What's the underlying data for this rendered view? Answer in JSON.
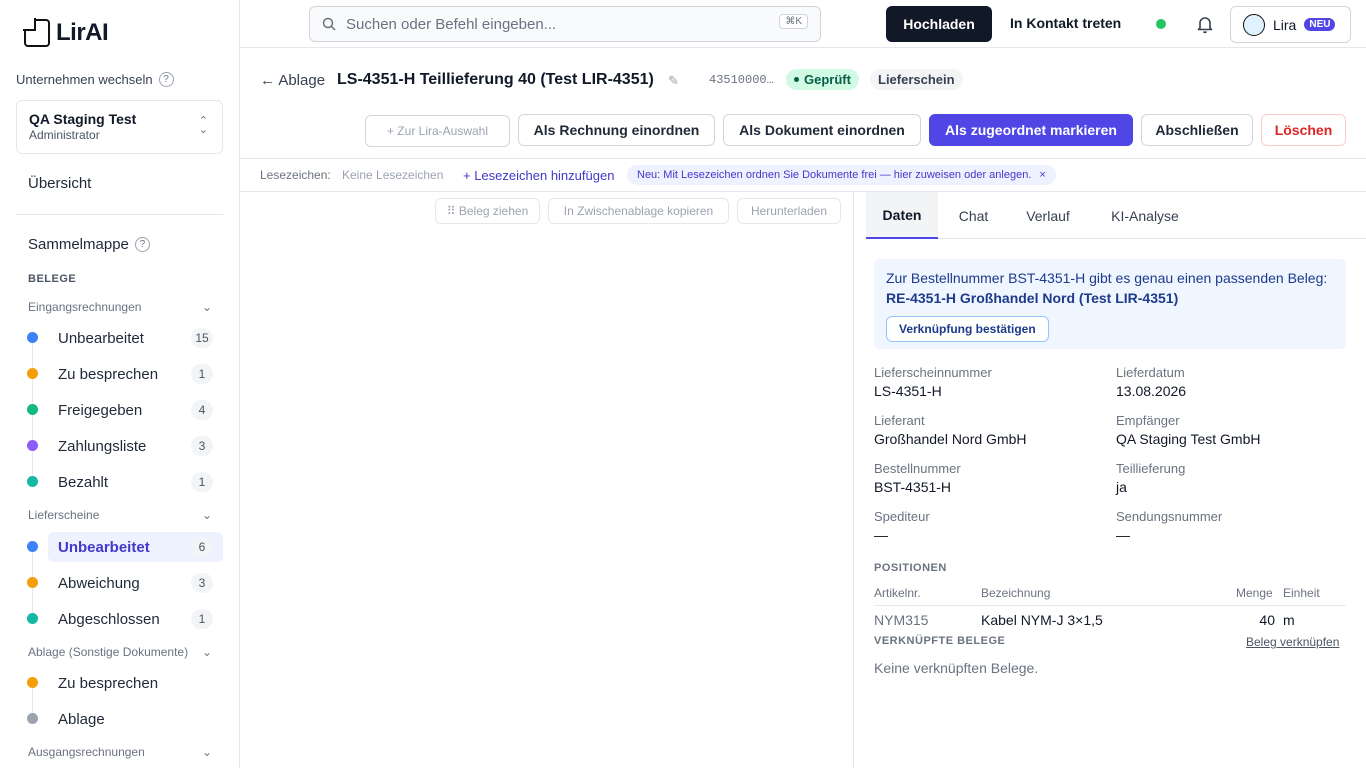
{
  "app": {
    "logo_text": "LirAI"
  },
  "sidebar": {
    "company_label": "Unternehmen wechseln",
    "help_glyph": "?",
    "company_name": "QA Staging Test",
    "company_role": "Administrator",
    "overview": "Übersicht",
    "sammelmappe": "Sammelmappe",
    "belege_header": "BELEGE",
    "groups": [
      {
        "label": "Eingangsrechnungen"
      },
      {
        "label": "Lieferscheine"
      },
      {
        "label": "Ablage (Sonstige Dokumente)"
      },
      {
        "label": "Ausgangsrechnungen"
      }
    ],
    "items": [
      {
        "label": "Unbearbeitet",
        "count": "15",
        "color": "#3b82f6"
      },
      {
        "label": "Zu besprechen",
        "count": "1",
        "color": "#f59e0b"
      },
      {
        "label": "Freigegeben",
        "count": "4",
        "color": "#10b981"
      },
      {
        "label": "Zahlungsliste",
        "count": "3",
        "color": "#8b5cf6"
      },
      {
        "label": "Bezahlt",
        "count": "1",
        "color": "#14b8a6"
      },
      {
        "label": "Unbearbeitet",
        "count": "6",
        "color": "#3b82f6"
      },
      {
        "label": "Abweichung",
        "count": "3",
        "color": "#f59e0b"
      },
      {
        "label": "Abgeschlossen",
        "count": "1",
        "color": "#14b8a6"
      },
      {
        "label": "Zu besprechen",
        "count": "",
        "color": "#f59e0b"
      },
      {
        "label": "Ablage",
        "count": "",
        "color": "#9ca3af"
      }
    ]
  },
  "topbar": {
    "search_placeholder": "Suchen oder Befehl eingeben...",
    "shortcut": "⌘K",
    "upload": "Hochladen",
    "contact": "In Kontakt treten",
    "lira": "Lira",
    "lira_badge": "NEU"
  },
  "document": {
    "back": "← Ablage",
    "title": "LS-4351-H Teillieferung 40 (Test LIR-4351)",
    "number": "43510000…",
    "status": "Geprüft",
    "type": "Lieferschein"
  },
  "actions": {
    "lira_select": "+ Zur Lira-Auswahl",
    "as_invoice": "Als Rechnung einordnen",
    "as_document": "Als Dokument einordnen",
    "mark_assigned": "Als zugeordnet markieren",
    "close": "Abschließen",
    "delete": "Löschen"
  },
  "bookmarks": {
    "label": "Lesezeichen:",
    "none": "Keine Lesezeichen",
    "add": "+ Lesezeichen hinzufügen",
    "info": "Neu: Mit Lesezeichen ordnen Sie Dokumente frei — hier zuweisen oder anlegen.",
    "close": "×"
  },
  "viewer": {
    "drag": "⠿ Beleg ziehen",
    "copy": "In Zwischenablage kopieren",
    "download": "Herunterladen"
  },
  "tabs": [
    "Daten",
    "Chat",
    "Verlauf",
    "KI-Analyse"
  ],
  "match": {
    "text": "Zur Bestellnummer BST-4351-H gibt es genau einen passenden Beleg: ",
    "bold": "RE-4351-H Großhandel Nord (Test LIR-4351)",
    "button": "Verknüpfung bestätigen"
  },
  "fields": [
    {
      "label": "Lieferscheinnummer",
      "value": "LS-4351-H"
    },
    {
      "label": "Lieferdatum",
      "value": "13.08.2026"
    },
    {
      "label": "Lieferant",
      "value": "Großhandel Nord GmbH"
    },
    {
      "label": "Empfänger",
      "value": "QA Staging Test GmbH"
    },
    {
      "label": "Bestellnummer",
      "value": "BST-4351-H"
    },
    {
      "label": "Teillieferung",
      "value": "ja"
    },
    {
      "label": "Spediteur",
      "value": "—"
    },
    {
      "label": "Sendungsnummer",
      "value": "—"
    }
  ],
  "positions": {
    "title": "POSITIONEN",
    "headers": [
      "Artikelnr.",
      "Bezeichnung",
      "Menge",
      "Einheit"
    ],
    "rows": [
      {
        "article": "NYM315",
        "description": "Kabel NYM-J 3×1,5",
        "qty": "40",
        "unit": "m"
      }
    ]
  },
  "linked": {
    "title": "VERKNÜPFTE BELEGE",
    "link": "Beleg verknüpfen",
    "empty": "Keine verknüpften Belege."
  }
}
